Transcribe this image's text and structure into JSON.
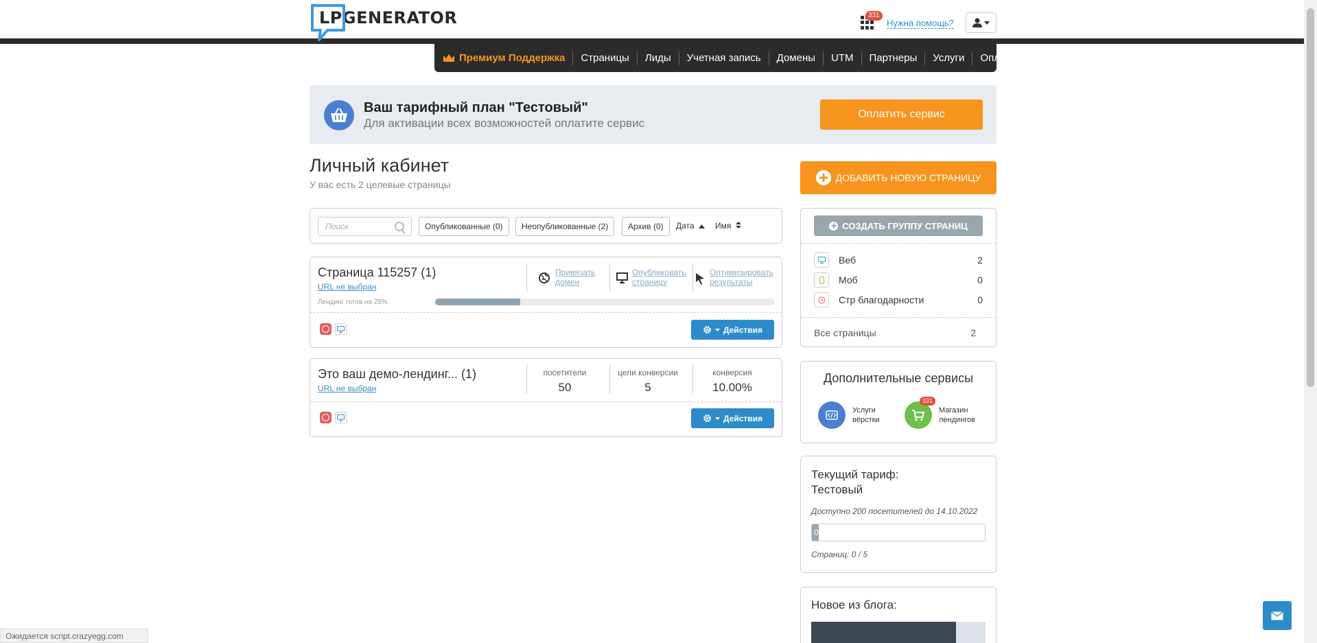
{
  "header": {
    "logo_text": "LPGENERATOR",
    "apps_badge": "331",
    "help_link": "Нужна помощь?"
  },
  "nav": {
    "premium": "Премиум Поддержка",
    "items": [
      "Страницы",
      "Лиды",
      "Учетная запись",
      "Домены",
      "UTM",
      "Партнеры",
      "Услуги",
      "Оплата"
    ]
  },
  "plan": {
    "title": "Ваш тарифный план \"Тестовый\"",
    "subtitle": "Для активации всех возможностей оплатите сервис",
    "pay_button": "Оплатить сервис"
  },
  "main": {
    "title": "Личный кабинет",
    "subtitle": "У вас есть 2 целевые страницы"
  },
  "filters": {
    "search_placeholder": "Поиск",
    "published": "Опубликованные (0)",
    "unpublished": "Неопубликованные (2)",
    "archive": "Архив (0)",
    "sort_date": "Дата",
    "sort_name": "Имя"
  },
  "pages": [
    {
      "title": "Страница 115257 (1)",
      "url": "URL не выбран",
      "actions": [
        {
          "line1": "Привязать",
          "line2": "домен"
        },
        {
          "line1": "Опубликовать",
          "line2": "страницу"
        },
        {
          "line1": "Оптимизировать",
          "line2": "результаты"
        }
      ],
      "ready_label": "Лендинг готов на 25%",
      "progress": 0.25,
      "actions_button": "Действия"
    },
    {
      "title": "Это ваш демо-лендинг... (1)",
      "url": "URL не выбран",
      "stats": [
        {
          "label": "посетители",
          "value": "50"
        },
        {
          "label": "цели конверсии",
          "value": "5"
        },
        {
          "label": "конверсия",
          "value": "10.00%"
        }
      ],
      "actions_button": "Действия"
    }
  ],
  "sidebar": {
    "add_page": "ДОБАВИТЬ НОВУЮ СТРАНИЦУ",
    "create_group": "СОЗДАТЬ ГРУППУ СТРАНИЦ",
    "types": [
      {
        "label": "Веб",
        "count": "2"
      },
      {
        "label": "Моб",
        "count": "0"
      },
      {
        "label": "Стр благодарности",
        "count": "0"
      }
    ],
    "all_pages": {
      "label": "Все страницы",
      "count": "2"
    },
    "services_title": "Дополнительные сервисы",
    "service1_line1": "Услуги",
    "service1_line2": "вёрстки",
    "service2_line1": "Магазин",
    "service2_line2": "лендингов",
    "service2_badge": "331",
    "tariff_line1": "Текущий тариф:",
    "tariff_line2": "Тестовый",
    "tariff_info": "Доступно 200 посетителей до 14.10.2022",
    "tariff_bar_text": "0",
    "tariff_progress": 0.0,
    "tariff_pages": "Страниц: 0 / 5",
    "blog_title": "Новое из блога:"
  },
  "status_bar": "Ожидается script.crazyegg.com",
  "colors": {
    "accent_orange": "#f7941d",
    "action_blue": "#2e8bc9",
    "nav_dark": "#2b2b2b"
  }
}
